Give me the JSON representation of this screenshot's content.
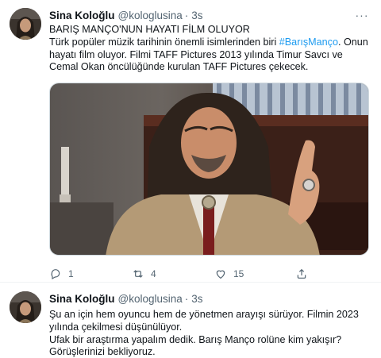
{
  "tweets": [
    {
      "author": {
        "name": "Sina Koloğlu",
        "handle": "@kologlusina"
      },
      "time": "3s",
      "title": "BARIŞ MANÇO'NUN HAYATI FİLM OLUYOR",
      "body_before_tag": "Türk popüler müzik tarihinin önemli isimlerinden biri ",
      "hashtag": "#BarışManço",
      "body_after_tag": ". Onun hayatı film oluyor. Filmi TAFF Pictures 2013 yılında Timur Savcı ve Cemal Okan öncülüğünde kurulan TAFF Pictures çekecek.",
      "stats": {
        "replies": "1",
        "retweets": "4",
        "likes": "15"
      }
    },
    {
      "author": {
        "name": "Sina Koloğlu",
        "handle": "@kologlusina"
      },
      "time": "3s",
      "lines": [
        "Şu an için hem oyuncu hem de yönetmen arayışı sürüyor. Filmin 2023 yılında çekilmesi düşünülüyor.",
        "Ufak bir araştırma yapalım dedik. Barış Manço rolüne kim yakışır? Görüşlerinizi bekliyoruz."
      ]
    }
  ],
  "ui": {
    "dot": "·",
    "more": "···"
  },
  "colors": {
    "accent": "#1d9bf0",
    "muted": "#536471",
    "text": "#0f1419",
    "border": "#cfd9de"
  },
  "icons": [
    "more-icon",
    "reply-icon",
    "retweet-icon",
    "like-icon",
    "share-icon"
  ]
}
